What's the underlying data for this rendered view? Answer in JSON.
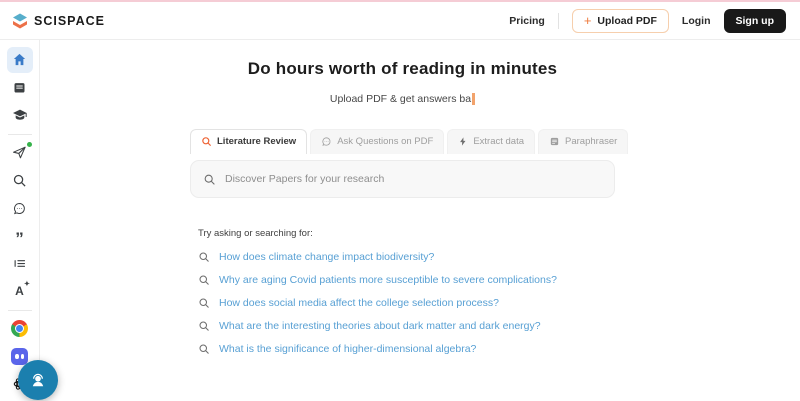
{
  "header": {
    "logo_text": "SCISPACE",
    "pricing": "Pricing",
    "upload_pdf": "Upload PDF",
    "login": "Login",
    "sign_up": "Sign up"
  },
  "sidebar": {
    "items": [
      {
        "icon": "home-icon",
        "active": true
      },
      {
        "icon": "library-icon"
      },
      {
        "icon": "graduation-cap-icon"
      },
      {
        "icon": "paper-plane-icon",
        "badge": "green-dot"
      },
      {
        "icon": "discover-search-icon"
      },
      {
        "icon": "chat-bubble-icon"
      },
      {
        "icon": "citation-quote-icon"
      },
      {
        "icon": "outline-list-icon"
      },
      {
        "icon": "ai-writer-icon"
      },
      {
        "icon": "chrome-icon"
      },
      {
        "icon": "discord-icon"
      },
      {
        "icon": "openai-icon"
      }
    ]
  },
  "hero": {
    "title": "Do hours worth of reading in minutes",
    "typing_text": "Upload PDF & get answers ba"
  },
  "tabs": [
    {
      "label": "Literature Review",
      "icon": "search-icon",
      "active": true
    },
    {
      "label": "Ask Questions on PDF",
      "icon": "chat-bubble-icon",
      "active": false
    },
    {
      "label": "Extract data",
      "icon": "lightning-bolt-icon",
      "active": false
    },
    {
      "label": "Paraphraser",
      "icon": "document-icon",
      "active": false
    }
  ],
  "search": {
    "placeholder": "Discover Papers for your research"
  },
  "suggestions": {
    "heading": "Try asking or searching for:",
    "items": [
      "How does climate change impact biodiversity?",
      "Why are aging Covid patients more susceptible to severe complications?",
      "How does social media affect the college selection process?",
      "What are the interesting theories about dark matter and dark energy?",
      "What is the significance of higher-dimensional algebra?"
    ]
  },
  "colors": {
    "accent_orange": "#ee6233",
    "link_blue": "#58a0d4",
    "home_active_blue": "#3a7bc8",
    "chat_fab_blue": "#1b7fae",
    "top_bar_pink": "#f5ccd5",
    "signup_black": "#191919",
    "discord_blurple": "#5a65ea"
  }
}
